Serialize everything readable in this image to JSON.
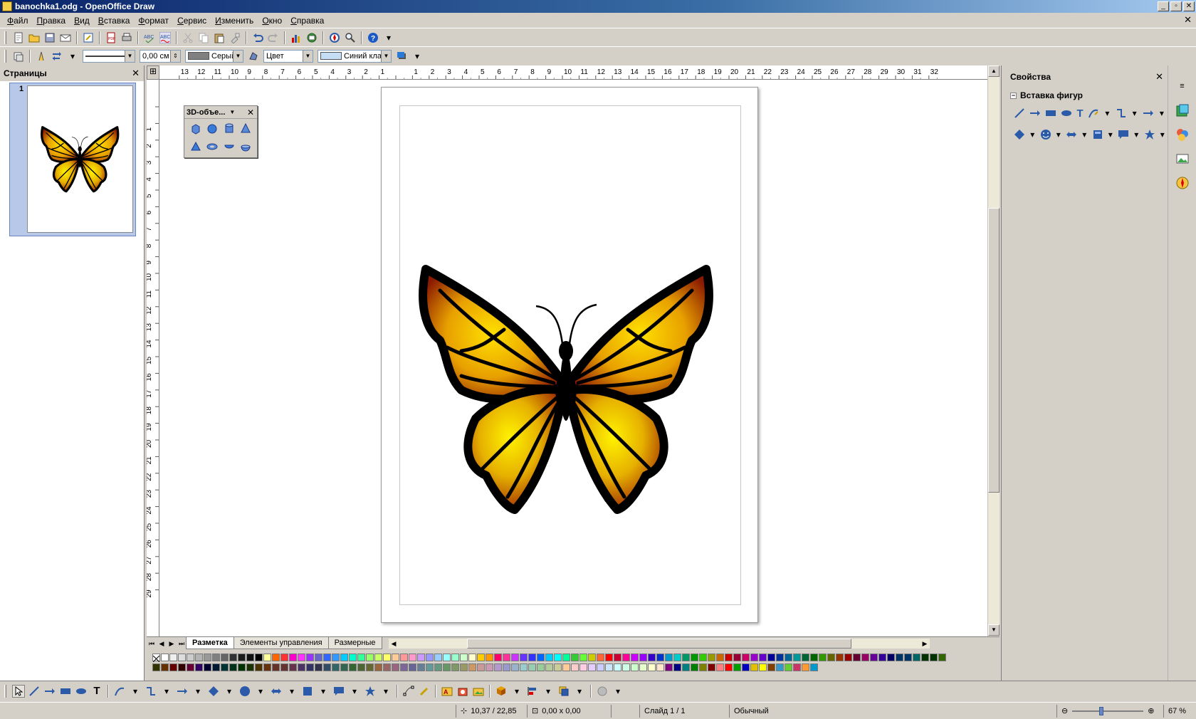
{
  "window": {
    "title": "banochka1.odg - OpenOffice Draw",
    "min_label": "_",
    "max_label": "▫",
    "close_label": "✕"
  },
  "menu": {
    "items": [
      "Файл",
      "Правка",
      "Вид",
      "Вставка",
      "Формат",
      "Сервис",
      "Изменить",
      "Окно",
      "Справка"
    ],
    "doc_close": "✕"
  },
  "line_toolbar": {
    "line_width": "0,00 см",
    "line_color": "Серый",
    "area_style": "Цвет",
    "fill_color": "Синий клас",
    "line_color_hex": "#808080",
    "fill_color_hex": "#c6def5"
  },
  "pages_panel": {
    "title": "Страницы",
    "close": "✕",
    "pages": [
      {
        "number": "1"
      }
    ]
  },
  "ruler": {
    "h_labels": [
      "13",
      "12",
      "11",
      "10",
      "9",
      "8",
      "7",
      "6",
      "5",
      "4",
      "3",
      "2",
      "1",
      "",
      "1",
      "2",
      "3",
      "4",
      "5",
      "6",
      "7",
      "8",
      "9",
      "10",
      "11",
      "12",
      "13",
      "14",
      "15",
      "16",
      "17",
      "18",
      "19",
      "20",
      "21",
      "22",
      "23",
      "24",
      "25",
      "26",
      "27",
      "28",
      "29",
      "30",
      "31",
      "32"
    ],
    "v_labels": [
      "",
      "1",
      "2",
      "3",
      "4",
      "5",
      "6",
      "7",
      "8",
      "9",
      "10",
      "11",
      "12",
      "13",
      "14",
      "15",
      "16",
      "17",
      "18",
      "19",
      "20",
      "21",
      "22",
      "23",
      "24",
      "25",
      "26",
      "27",
      "28",
      "29"
    ]
  },
  "float_toolbar": {
    "title": "3D-объе...",
    "close": "✕"
  },
  "tabs": {
    "items": [
      {
        "label": "Разметка",
        "active": true
      },
      {
        "label": "Элементы управления",
        "active": false
      },
      {
        "label": "Размерные",
        "active": false
      }
    ]
  },
  "palette": {
    "row1": [
      "#ffffff",
      "#eeeeee",
      "#dddddd",
      "#cccccc",
      "#b3b3b3",
      "#999999",
      "#808080",
      "#666666",
      "#333333",
      "#1c1c1c",
      "#111111",
      "#000000",
      "#ffff99",
      "#ff6600",
      "#ff3333",
      "#ff00cc",
      "#ff33ff",
      "#9933ff",
      "#6666cc",
      "#3366ff",
      "#3399ff",
      "#00ccff",
      "#00ffcc",
      "#33ff99",
      "#99ff66",
      "#ccff66",
      "#ffff66",
      "#ffcc99",
      "#ff9999",
      "#ff99cc",
      "#cc99ff",
      "#9999ff",
      "#99ccff",
      "#99ffff",
      "#99ffcc",
      "#ccffcc",
      "#ffffcc",
      "#ffcc00",
      "#ff9900",
      "#ff0066",
      "#ff3399",
      "#cc33ff",
      "#6633ff",
      "#3333ff",
      "#0066ff",
      "#00ccff",
      "#00ffff",
      "#00ff99",
      "#33cc33",
      "#66ff33",
      "#cccc00",
      "#ff6633",
      "#ff0000",
      "#cc0033",
      "#ff0099",
      "#cc00ff",
      "#9900ff",
      "#3300cc",
      "#0033cc",
      "#0099cc",
      "#00cccc",
      "#009966",
      "#009900",
      "#33cc00",
      "#999900",
      "#cc6600",
      "#cc0000",
      "#990033",
      "#cc0066",
      "#9900cc",
      "#6600cc",
      "#000099",
      "#003399",
      "#006699",
      "#009999",
      "#006633",
      "#006600",
      "#339900",
      "#666600",
      "#993300",
      "#990000",
      "#660033",
      "#990066",
      "#660099",
      "#330099",
      "#000066",
      "#003366",
      "#003366",
      "#006666",
      "#003300",
      "#003300",
      "#336600"
    ],
    "row2": [
      "#333300",
      "#663300",
      "#660000",
      "#330000",
      "#660033",
      "#330066",
      "#000033",
      "#001a33",
      "#003333",
      "#003319",
      "#003300",
      "#1a3300",
      "#4d3300",
      "#66330f",
      "#663326",
      "#663333",
      "#66334d",
      "#4d3366",
      "#333366",
      "#33334d",
      "#334d66",
      "#336666",
      "#336650",
      "#336633",
      "#4d6633",
      "#666633",
      "#99663d",
      "#996666",
      "#99667f",
      "#7f6699",
      "#666699",
      "#667f99",
      "#669999",
      "#669980",
      "#669966",
      "#7f9966",
      "#999966",
      "#cc9966",
      "#cc9999",
      "#cc99b3",
      "#b399cc",
      "#9999cc",
      "#99b3cc",
      "#99cccc",
      "#99ccb3",
      "#99cc99",
      "#b3cc99",
      "#cccc99",
      "#ffcc99",
      "#ffcccc",
      "#ffcce5",
      "#e5ccff",
      "#ccccff",
      "#cce5ff",
      "#ccffff",
      "#ccffe5",
      "#ccffcc",
      "#e5ffcc",
      "#ffffcc",
      "#ffe5cc",
      "#800080",
      "#000080",
      "#008080",
      "#008000",
      "#808000",
      "#800000",
      "#ff8080",
      "#ff0000",
      "#00a000",
      "#0000c0",
      "#e0c000",
      "#ffff00",
      "#804000",
      "#3399cc",
      "#66cc33",
      "#cc3366",
      "#ff9933",
      "#0099cc"
    ]
  },
  "properties_panel": {
    "title": "Свойства",
    "close": "✕",
    "section_title": "Вставка фигур",
    "minus": "−"
  },
  "status": {
    "position": "10,37 / 22,85",
    "size": "0,00 x 0,00",
    "slide": "Слайд 1 / 1",
    "style": "Обычный",
    "zoom_minus": "⊖",
    "zoom_plus": "⊕",
    "zoom": "67 %"
  }
}
